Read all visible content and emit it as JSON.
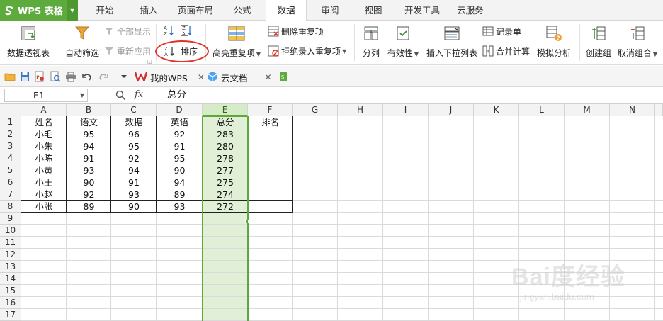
{
  "app": {
    "title": "WPS 表格"
  },
  "menu": {
    "tabs": [
      "开始",
      "插入",
      "页面布局",
      "公式",
      "数据",
      "审阅",
      "视图",
      "开发工具",
      "云服务"
    ],
    "active": "数据"
  },
  "ribbon": {
    "pivot_table": "数据透视表",
    "auto_filter": "自动筛选",
    "show_all": "全部显示",
    "reapply": "重新应用",
    "sort": "排序",
    "highlight_duplicates": "高亮重复项",
    "delete_duplicates": "删除重复项",
    "reject_duplicates": "拒绝录入重复项",
    "split_column": "分列",
    "validity": "有效性",
    "insert_dropdown": "插入下拉列表",
    "record_form": "记录单",
    "consolidate": "合并计算",
    "what_if": "模拟分析",
    "group": "创建组",
    "ungroup": "取消组合"
  },
  "doc_tabs": [
    "我的WPS",
    "云文档"
  ],
  "formula_bar": {
    "cell_ref": "E1",
    "fx": "fx",
    "content": "总分"
  },
  "sheet": {
    "columns": [
      "A",
      "B",
      "C",
      "D",
      "E",
      "F",
      "G",
      "H",
      "I",
      "J",
      "K",
      "L",
      "M",
      "N"
    ],
    "row_numbers": [
      "1",
      "2",
      "3",
      "4",
      "5",
      "6",
      "7",
      "8",
      "9",
      "10",
      "11",
      "12",
      "13",
      "14",
      "15",
      "16",
      "17"
    ],
    "headers": [
      "姓名",
      "语文",
      "数据",
      "英语",
      "总分",
      "排名"
    ],
    "rows": [
      [
        "小毛",
        "95",
        "96",
        "92",
        "283",
        ""
      ],
      [
        "小朱",
        "94",
        "95",
        "91",
        "280",
        ""
      ],
      [
        "小陈",
        "91",
        "92",
        "95",
        "278",
        ""
      ],
      [
        "小黄",
        "93",
        "94",
        "90",
        "277",
        ""
      ],
      [
        "小王",
        "90",
        "91",
        "94",
        "275",
        ""
      ],
      [
        "小赵",
        "92",
        "93",
        "89",
        "274",
        ""
      ],
      [
        "小张",
        "89",
        "90",
        "93",
        "272",
        ""
      ]
    ],
    "selected_column": "E"
  },
  "watermark": {
    "brand": "Bai度经验",
    "site": "jingyan.baidu.com"
  },
  "colors": {
    "accent": "#5cab3c",
    "selection": "#5da83b",
    "highlight_ring": "#e0342a"
  }
}
